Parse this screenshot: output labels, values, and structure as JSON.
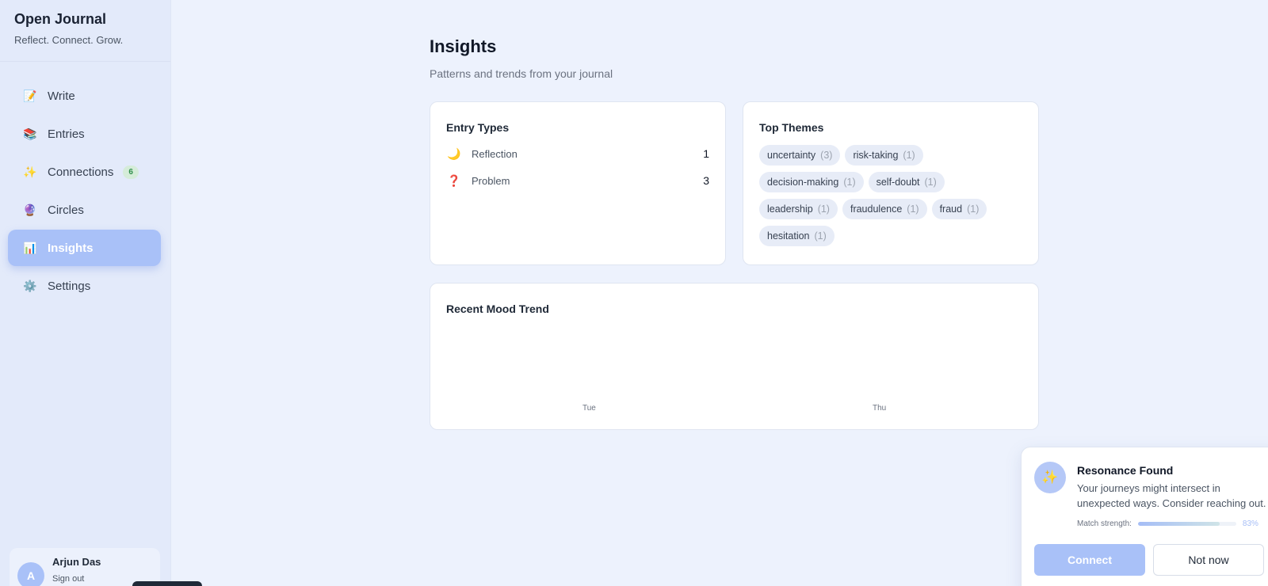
{
  "brand": {
    "title": "Open Journal",
    "tagline": "Reflect. Connect. Grow."
  },
  "nav": [
    {
      "label": "Write",
      "icon": "📝",
      "icon_name": "memo-icon"
    },
    {
      "label": "Entries",
      "icon": "📚",
      "icon_name": "books-icon"
    },
    {
      "label": "Connections",
      "icon": "✨",
      "icon_name": "sparkles-icon",
      "badge": "6"
    },
    {
      "label": "Circles",
      "icon": "🔮",
      "icon_name": "crystal-ball-icon"
    },
    {
      "label": "Insights",
      "icon": "📊",
      "icon_name": "bar-chart-icon",
      "active": true
    },
    {
      "label": "Settings",
      "icon": "⚙️",
      "icon_name": "gear-icon"
    }
  ],
  "user": {
    "initial": "A",
    "name": "Arjun Das",
    "sign_out": "Sign out"
  },
  "page": {
    "title": "Insights",
    "subtitle": "Patterns and trends from your journal"
  },
  "entry_types": {
    "title": "Entry Types",
    "items": [
      {
        "icon": "🌙",
        "icon_name": "moon-icon",
        "label": "Reflection",
        "count": "1"
      },
      {
        "icon": "❓",
        "icon_name": "question-mark-icon",
        "label": "Problem",
        "count": "3"
      }
    ]
  },
  "top_themes": {
    "title": "Top Themes",
    "themes": [
      {
        "name": "uncertainty",
        "count": "(3)"
      },
      {
        "name": "risk-taking",
        "count": "(1)"
      },
      {
        "name": "decision-making",
        "count": "(1)"
      },
      {
        "name": "self-doubt",
        "count": "(1)"
      },
      {
        "name": "leadership",
        "count": "(1)"
      },
      {
        "name": "fraudulence",
        "count": "(1)"
      },
      {
        "name": "fraud",
        "count": "(1)"
      },
      {
        "name": "hesitation",
        "count": "(1)"
      }
    ]
  },
  "mood_trend": {
    "title": "Recent Mood Trend",
    "days": [
      "Tue",
      "Thu"
    ]
  },
  "toast": {
    "icon": "✨",
    "title": "Resonance Found",
    "message": "Your journeys might intersect in unexpected ways. Consider reaching out.",
    "match_label": "Match strength:",
    "match_value": 0.83,
    "match_pct": "83%",
    "connect_label": "Connect",
    "not_now_label": "Not now"
  },
  "colors": {
    "accent": "#a9c1f8",
    "background": "#edf2fd",
    "sidebar": "#e3eafa",
    "badge_green": "#2f8f4a"
  }
}
